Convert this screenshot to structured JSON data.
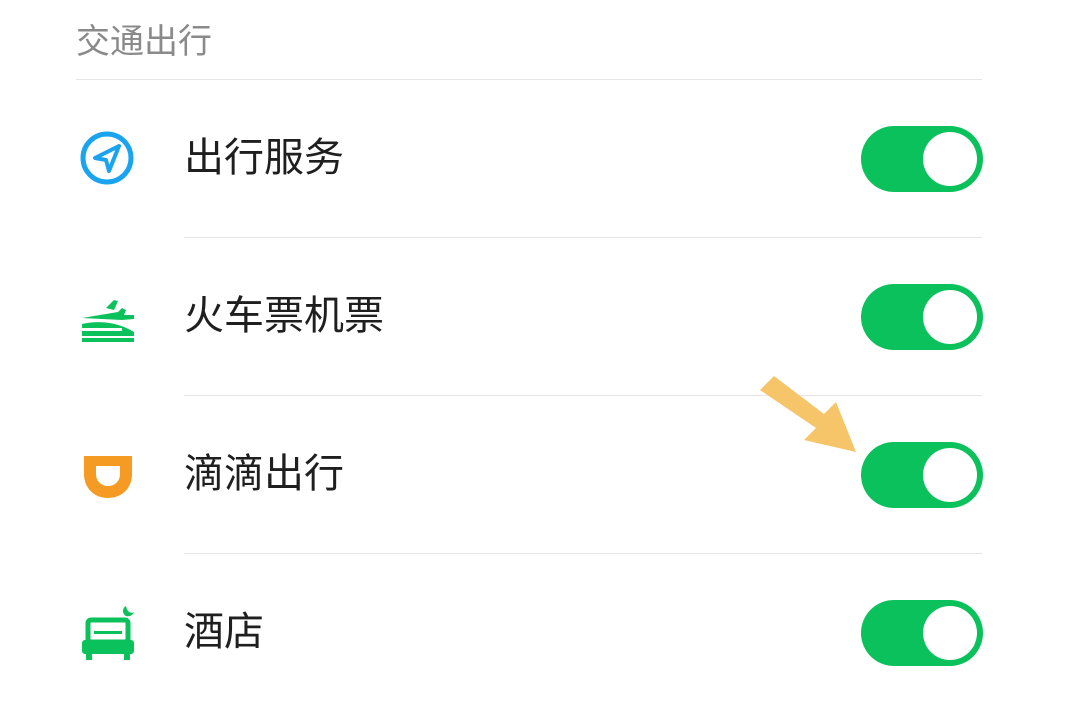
{
  "section": {
    "title": "交通出行"
  },
  "items": [
    {
      "label": "出行服务",
      "icon": "navigation-arrow-icon",
      "icon_color": "#1aa3ef",
      "enabled": true
    },
    {
      "label": "火车票机票",
      "icon": "train-plane-icon",
      "icon_color": "#0bc15c",
      "enabled": true
    },
    {
      "label": "滴滴出行",
      "icon": "didi-logo-icon",
      "icon_color": "#f59a23",
      "enabled": true
    },
    {
      "label": "酒店",
      "icon": "hotel-bed-icon",
      "icon_color": "#0bc15c",
      "enabled": true
    }
  ],
  "colors": {
    "toggle_on": "#0bc15c",
    "annotation_arrow": "#f6c56a"
  },
  "annotation": {
    "icon": "pointer-arrow-icon",
    "target": "滴滴出行 toggle"
  }
}
